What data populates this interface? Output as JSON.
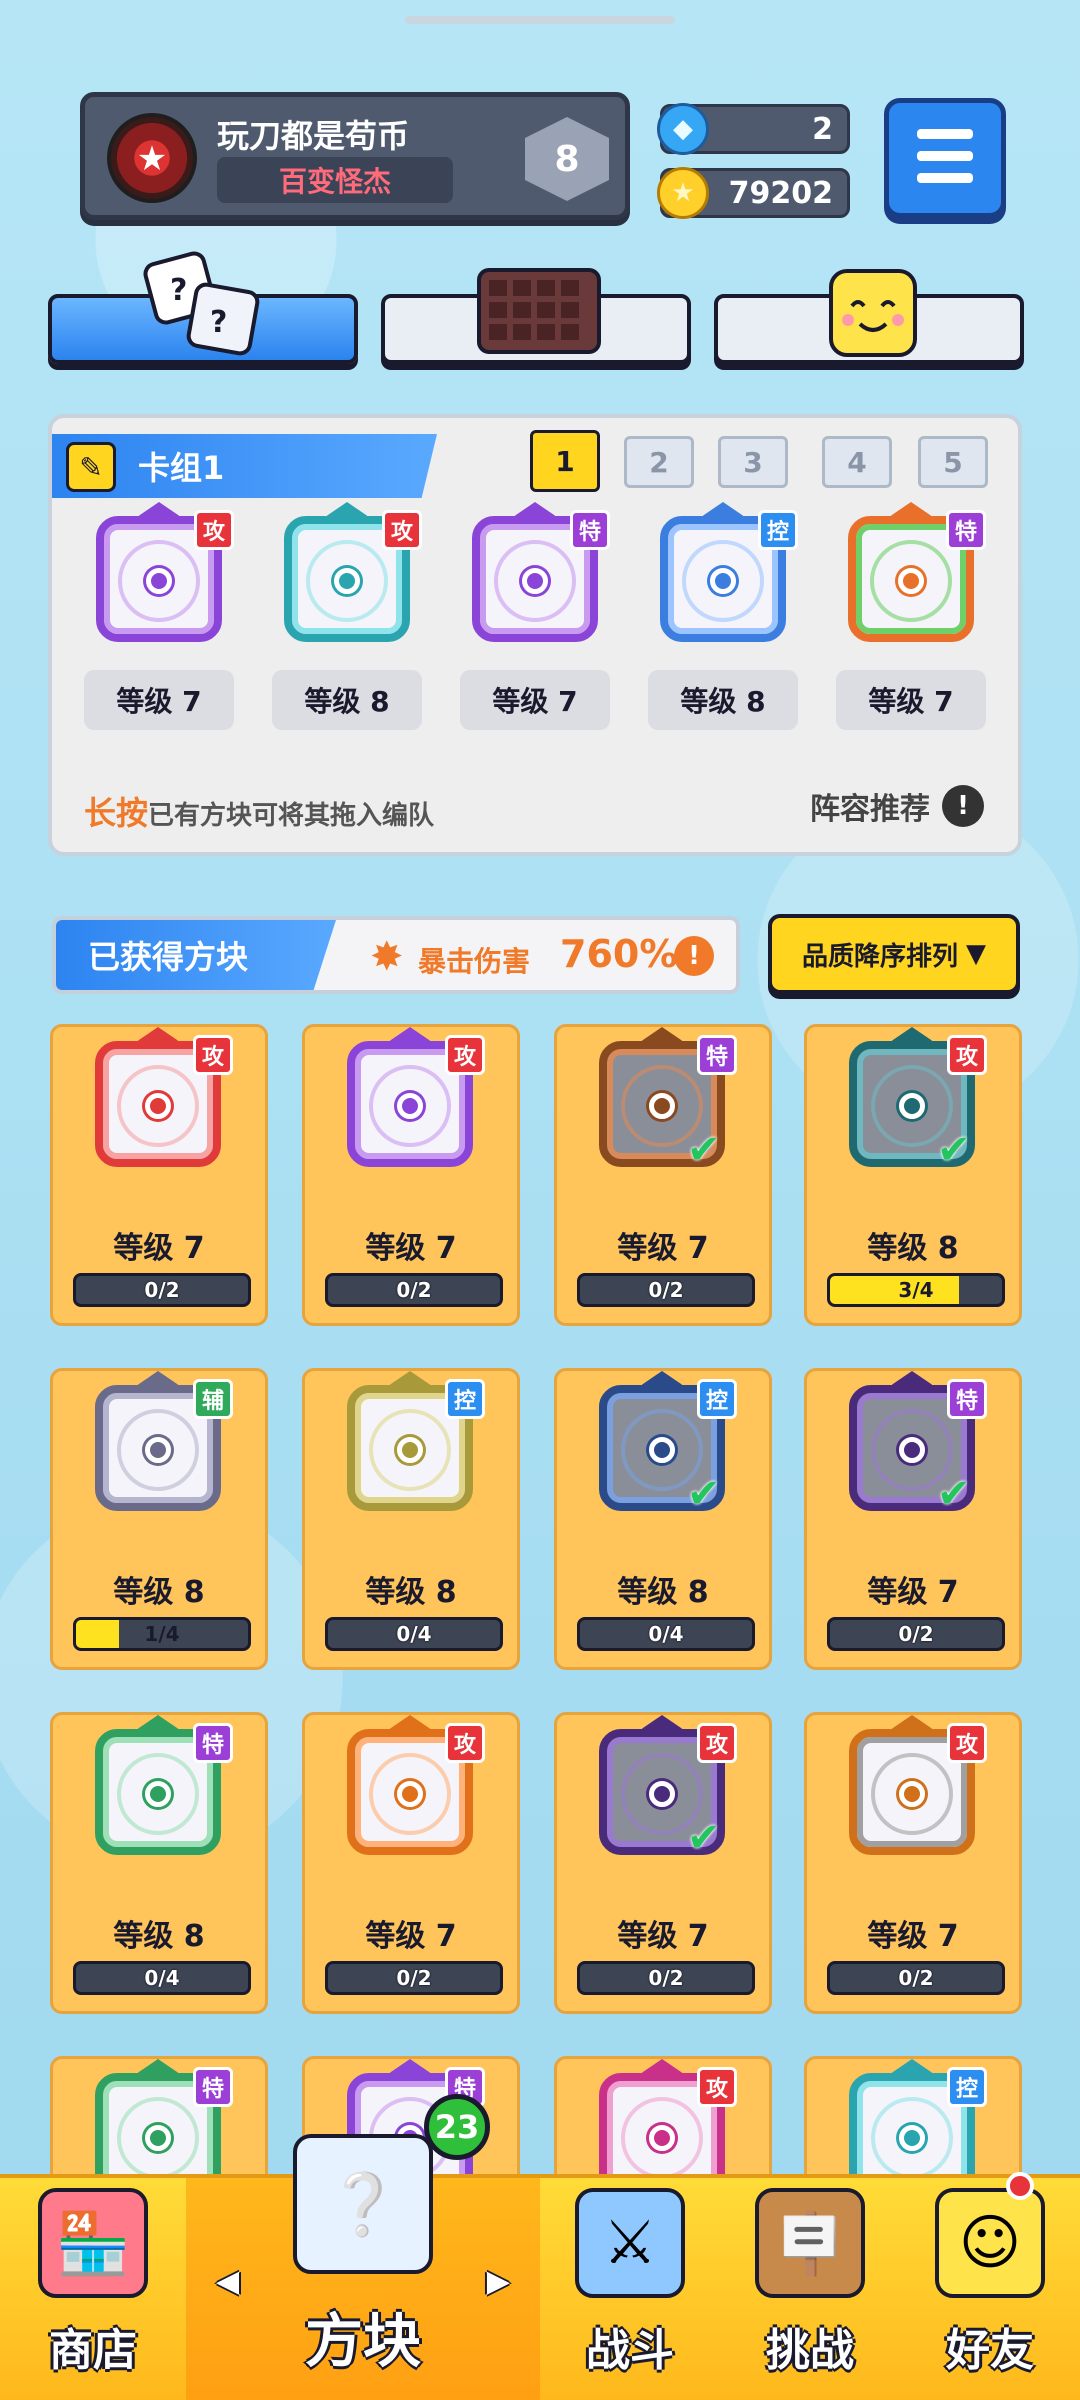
{
  "player": {
    "name": "玩刀都是苟币",
    "title": "百变怪杰",
    "rank": "8"
  },
  "currency": {
    "gems": "2",
    "coins": "79202"
  },
  "tabs": [
    {
      "name": "dice",
      "icon": "dice-icon"
    },
    {
      "name": "board",
      "icon": "board-grid-icon"
    },
    {
      "name": "emote",
      "icon": "smile-face-icon"
    }
  ],
  "deck": {
    "label": "卡组1",
    "slots": [
      "1",
      "2",
      "3",
      "4",
      "5"
    ],
    "active_slot": "1",
    "cards": [
      {
        "level": "等级 7",
        "tag": "攻",
        "color": "#8a45d8",
        "accent": "#c89af0"
      },
      {
        "level": "等级 8",
        "tag": "攻",
        "color": "#2aa5b0",
        "accent": "#8fe3ea"
      },
      {
        "level": "等级 7",
        "tag": "特",
        "color": "#8a45d8",
        "accent": "#c89af0"
      },
      {
        "level": "等级 8",
        "tag": "控",
        "color": "#3b7ee0",
        "accent": "#9cc4ff"
      },
      {
        "level": "等级 7",
        "tag": "特",
        "color": "#e8702a",
        "accent": "#6fd06a"
      }
    ],
    "hint_emphasis": "长按",
    "hint_text": "已有方块可将其拖入编队",
    "recommend_label": "阵容推荐"
  },
  "acquired": {
    "label": "已获得方块",
    "crit_label": "暴击伤害",
    "crit_value": "760%",
    "sort_label": "品质降序排列"
  },
  "dice_grid": [
    {
      "level": "等级 7",
      "progress": "0/2",
      "fill": 0,
      "tag": "攻",
      "color": "#e03a3a",
      "accent": "#f7a3a3",
      "owned": false
    },
    {
      "level": "等级 7",
      "progress": "0/2",
      "fill": 0,
      "tag": "攻",
      "color": "#8a45d8",
      "accent": "#c89af0",
      "owned": false
    },
    {
      "level": "等级 7",
      "progress": "0/2",
      "fill": 0,
      "tag": "特",
      "color": "#8a4a20",
      "accent": "#d98a5a",
      "owned": true
    },
    {
      "level": "等级 8",
      "progress": "3/4",
      "fill": 0.75,
      "tag": "攻",
      "color": "#1e6a70",
      "accent": "#6fb8bf",
      "owned": true
    },
    {
      "level": "等级 8",
      "progress": "1/4",
      "fill": 0.25,
      "tag": "辅",
      "color": "#6a6a8a",
      "accent": "#b5b5cf",
      "owned": false
    },
    {
      "level": "等级 8",
      "progress": "0/4",
      "fill": 0,
      "tag": "控",
      "color": "#a89a3a",
      "accent": "#e0d58a",
      "owned": false
    },
    {
      "level": "等级 8",
      "progress": "0/4",
      "fill": 0,
      "tag": "控",
      "color": "#2a4a8a",
      "accent": "#7aa0e0",
      "owned": true
    },
    {
      "level": "等级 7",
      "progress": "0/2",
      "fill": 0,
      "tag": "特",
      "color": "#4a2a7a",
      "accent": "#9a7ad0",
      "owned": true
    },
    {
      "level": "等级 8",
      "progress": "0/4",
      "fill": 0,
      "tag": "特",
      "color": "#2fa060",
      "accent": "#9ee0b8",
      "owned": false
    },
    {
      "level": "等级 7",
      "progress": "0/2",
      "fill": 0,
      "tag": "攻",
      "color": "#e0701a",
      "accent": "#ffb27a",
      "owned": false
    },
    {
      "level": "等级 7",
      "progress": "0/2",
      "fill": 0,
      "tag": "攻",
      "color": "#4a2a7a",
      "accent": "#9a7ad0",
      "owned": true
    },
    {
      "level": "等级 7",
      "progress": "0/2",
      "fill": 0,
      "tag": "攻",
      "color": "#d0701a",
      "accent": "#a0a0a0",
      "owned": false
    },
    {
      "level": "",
      "progress": "",
      "fill": 0,
      "tag": "特",
      "color": "#2fa060",
      "accent": "#9ee0b8",
      "owned": false
    },
    {
      "level": "",
      "progress": "",
      "fill": 0,
      "tag": "特",
      "color": "#8a45d8",
      "accent": "#c89af0",
      "owned": false
    },
    {
      "level": "",
      "progress": "",
      "fill": 0,
      "tag": "攻",
      "color": "#c8308a",
      "accent": "#f0a0d0",
      "owned": false
    },
    {
      "level": "",
      "progress": "",
      "fill": 0,
      "tag": "控",
      "color": "#2aa5b0",
      "accent": "#8fe3ea",
      "owned": false
    }
  ],
  "nav": {
    "shop": "商店",
    "dice": "方块",
    "battle": "战斗",
    "challenge": "挑战",
    "friends": "好友",
    "dice_badge": "23"
  }
}
